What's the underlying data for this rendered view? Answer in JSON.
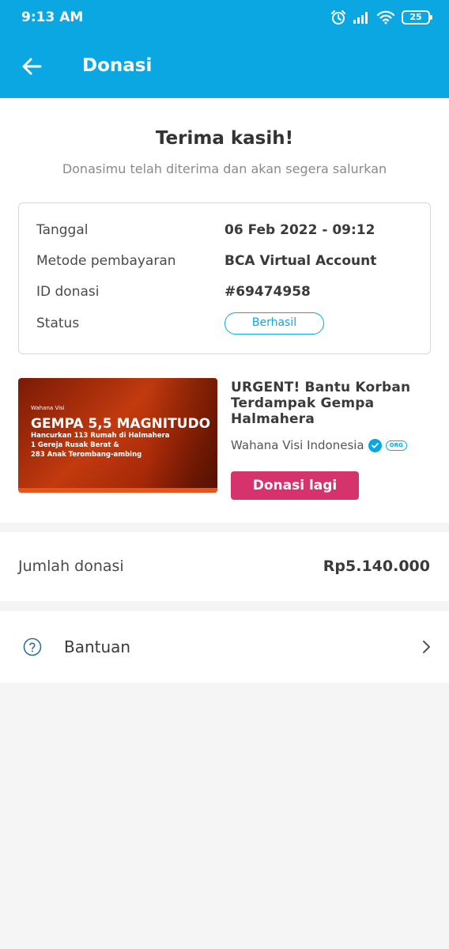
{
  "status_bar": {
    "time": "9:13 AM",
    "battery": "25",
    "icons": [
      "alarm-icon",
      "signal-icon",
      "wifi-icon",
      "battery-icon"
    ]
  },
  "app_bar": {
    "title": "Donasi",
    "back_icon": "arrow-left-icon"
  },
  "confirmation": {
    "title": "Terima kasih!",
    "subtitle": "Donasimu telah diterima dan akan segera salurkan"
  },
  "details": [
    {
      "label": "Tanggal",
      "value": "06 Feb 2022 - 09:12"
    },
    {
      "label": "Metode pembayaran",
      "value": "BCA Virtual Account"
    },
    {
      "label": "ID donasi",
      "value": "#69474958"
    },
    {
      "label": "Status",
      "value": "Berhasil"
    }
  ],
  "campaign": {
    "image": {
      "org": "Wahana Visi",
      "headline": "GEMPA 5,5 MAGNITUDO",
      "lines": [
        "Hancurkan 113 Rumah di Halmahera",
        "1 Gereja Rusak Berat &",
        "283 Anak Terombang-ambing"
      ]
    },
    "title": "URGENT! Bantu Korban Terdampak Gempa Halmahera",
    "organizer": "Wahana Visi Indonesia",
    "org_badge": "ORG",
    "donate_again_label": "Donasi lagi"
  },
  "amount": {
    "label": "Jumlah donasi",
    "value": "Rp5.140.000"
  },
  "help": {
    "label": "Bantuan",
    "icon": "help-circle-icon",
    "chevron": "chevron-right-icon"
  },
  "colors": {
    "primary": "#0aa7e3",
    "accent": "#d6336c",
    "background": "#f5f5f5"
  }
}
